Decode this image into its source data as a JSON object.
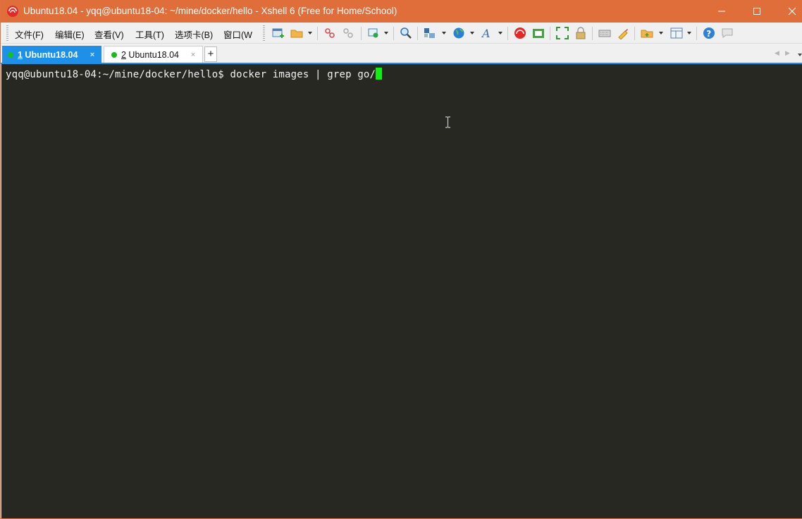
{
  "window": {
    "title": "Ubuntu18.04 - yqq@ubuntu18-04: ~/mine/docker/hello - Xshell 6 (Free for Home/School)",
    "app_icon": "xshell-logo-icon",
    "controls": [
      "minimize-icon",
      "maximize-icon",
      "close-icon"
    ]
  },
  "menu": {
    "items": [
      {
        "label": "文件(F)"
      },
      {
        "label": "编辑(E)"
      },
      {
        "label": "查看(V)"
      },
      {
        "label": "工具(T)"
      },
      {
        "label": "选项卡(B)"
      },
      {
        "label": "窗口(W"
      }
    ]
  },
  "toolbar": {
    "icons": [
      "new-session-icon",
      "open-folder-icon",
      "connect-icon",
      "disconnect-icon",
      "properties-icon",
      "find-icon",
      "transfer-icon",
      "globe-icon",
      "font-icon",
      "xshell-icon",
      "xftp-icon",
      "fullscreen-icon",
      "lock-icon",
      "keyboard-icon",
      "highlight-icon",
      "compose-icon",
      "layout-icon",
      "help-icon",
      "chat-icon"
    ]
  },
  "tabs": [
    {
      "number": "1",
      "name": " Ubuntu18.04",
      "close": "×",
      "active": true
    },
    {
      "number": "2",
      "name": " Ubuntu18.04",
      "close": "×",
      "active": false
    }
  ],
  "tabbar": {
    "add_label": "+"
  },
  "terminal": {
    "prompt": "yqq@ubuntu18-04:~/mine/docker/hello$ ",
    "command": "docker images | grep go/",
    "background": "#272822",
    "foreground": "#f1f1f1",
    "cursor_color": "#11ee11"
  },
  "colors": {
    "titlebar": "#df6e3b",
    "active_tab": "#1e90e8",
    "status_dot": "#16c01f"
  }
}
